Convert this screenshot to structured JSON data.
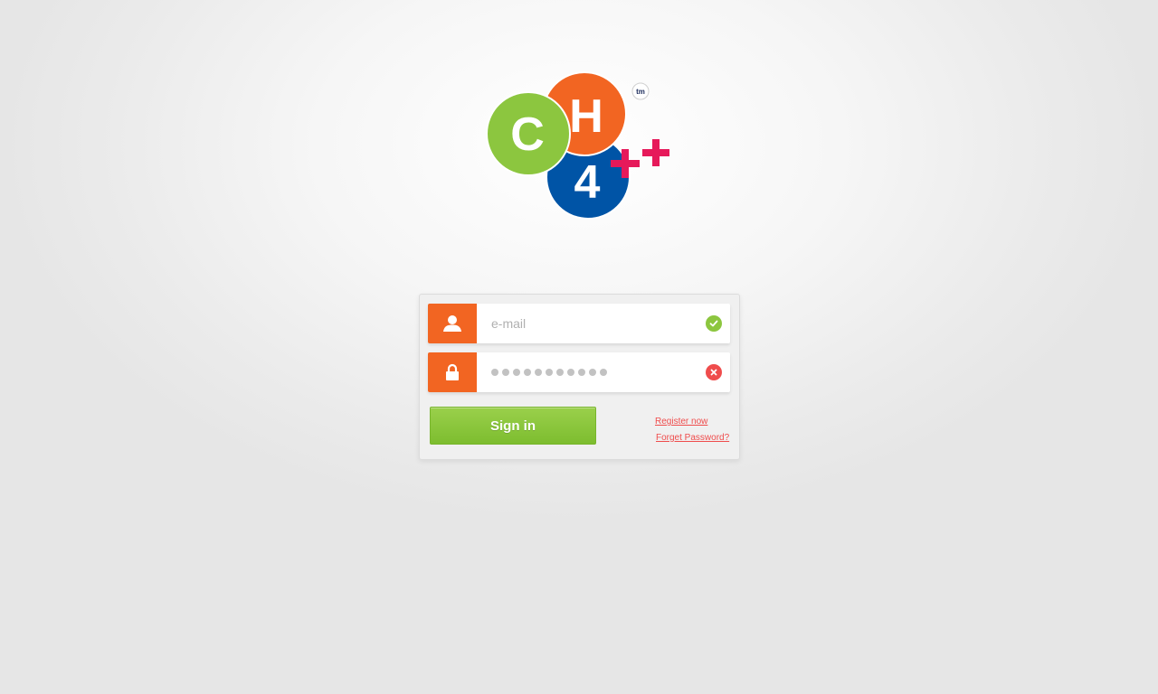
{
  "logo": {
    "letter_c": "C",
    "letter_h": "H",
    "digit": "4",
    "trademark": "tm",
    "colors": {
      "green": "#8cc63f",
      "orange": "#f26522",
      "blue": "#0054a6",
      "magenta": "#e6195a"
    }
  },
  "login": {
    "email": {
      "placeholder": "e-mail",
      "value": "",
      "icon": "user-icon",
      "status_icon": "check-icon"
    },
    "password": {
      "masked_length": 11,
      "icon": "lock-icon",
      "status_icon": "error-x-icon"
    },
    "signin_label": "Sign in",
    "register_label": "Register now",
    "forgot_label": "Forget Password?"
  },
  "colors": {
    "accent": "#f26522",
    "button": "#8cc63f",
    "link": "#ef4c4c",
    "valid": "#8cc63f",
    "invalid": "#ef4c4c"
  }
}
